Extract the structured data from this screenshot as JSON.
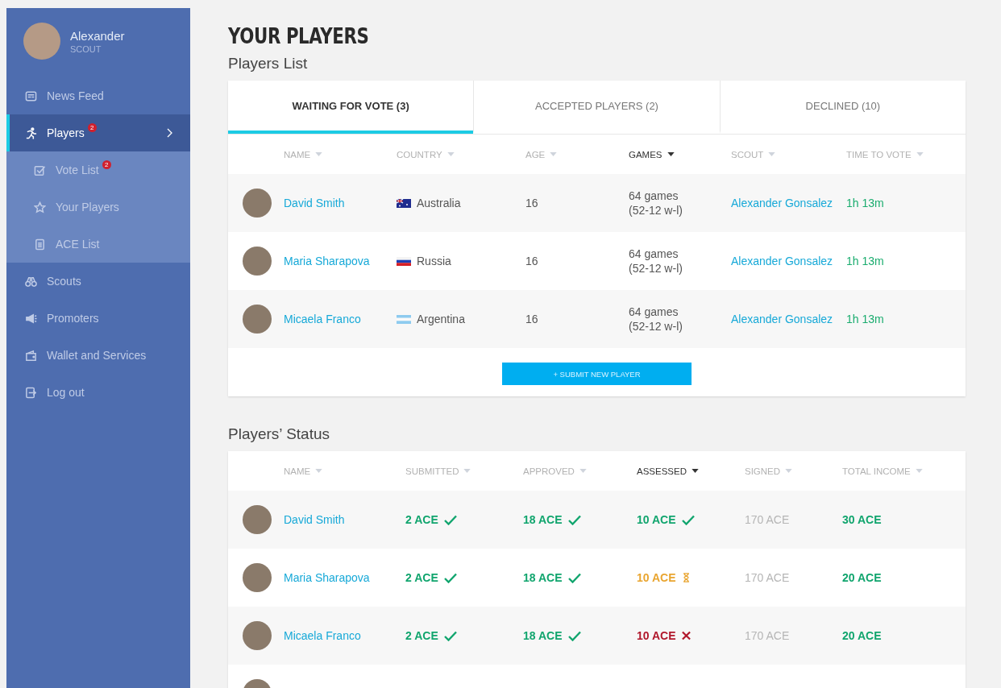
{
  "user": {
    "name": "Alexander",
    "role": "SCOUT"
  },
  "nav": [
    {
      "label": "News Feed",
      "selected": false
    },
    {
      "label": "Players",
      "selected": true,
      "badge": "2",
      "children": [
        {
          "label": "Vote List",
          "badge": "2",
          "selected": false
        },
        {
          "label": "Your Players",
          "selected": false
        },
        {
          "label": "ACE List",
          "selected": false
        }
      ]
    },
    {
      "label": "Scouts",
      "selected": false
    },
    {
      "label": "Promoters",
      "selected": false
    },
    {
      "label": "Wallet and Services",
      "selected": false
    },
    {
      "label": "Log out",
      "selected": false
    }
  ],
  "page_title": "YOUR PLAYERS",
  "list_title": "Players List",
  "tabs": [
    {
      "label": "WAITING FOR VOTE (3)",
      "selected": true
    },
    {
      "label": "ACCEPTED PLAYERS (2)",
      "selected": false
    },
    {
      "label": "DECLINED (10)",
      "selected": false
    }
  ],
  "list_columns": [
    {
      "label": "NAME",
      "sorted": false
    },
    {
      "label": "COUNTRY",
      "sorted": false
    },
    {
      "label": "AGE",
      "sorted": false
    },
    {
      "label": "GAMES",
      "sorted": true
    },
    {
      "label": "SCOUT",
      "sorted": false
    },
    {
      "label": "TIME TO VOTE",
      "sorted": false
    }
  ],
  "list_rows": [
    {
      "name": "David Smith",
      "country": "Australia",
      "age": "16",
      "games": "64 games",
      "record": "(52-12 w-l)",
      "scout": "Alexander Gonsalez",
      "time": "1h 13m"
    },
    {
      "name": "Maria Sharapova",
      "country": "Russia",
      "age": "16",
      "games": "64 games",
      "record": "(52-12 w-l)",
      "scout": "Alexander Gonsalez",
      "time": "1h 13m"
    },
    {
      "name": "Micaela Franco",
      "country": "Argentina",
      "age": "16",
      "games": "64 games",
      "record": "(52-12 w-l)",
      "scout": "Alexander Gonsalez",
      "time": "1h 13m"
    }
  ],
  "submit_button": "+ SUBMIT NEW PLAYER",
  "status_title": "Players’ Status",
  "status_columns": [
    {
      "label": "NAME",
      "sorted": false
    },
    {
      "label": "SUBMITTED",
      "sorted": false
    },
    {
      "label": "APPROVED",
      "sorted": false
    },
    {
      "label": "ASSESSED",
      "sorted": true
    },
    {
      "label": "SIGNED",
      "sorted": false
    },
    {
      "label": "TOTAL INCOME",
      "sorted": false
    }
  ],
  "status_rows": [
    {
      "name": "David Smith",
      "cells": [
        {
          "text": "2 ACE",
          "kind": "done"
        },
        {
          "text": "18 ACE",
          "kind": "done"
        },
        {
          "text": "10 ACE",
          "kind": "done"
        },
        {
          "text": "170 ACE",
          "kind": "muted"
        },
        {
          "text": "30 ACE",
          "kind": "income"
        }
      ]
    },
    {
      "name": "Maria Sharapova",
      "cells": [
        {
          "text": "2 ACE",
          "kind": "done"
        },
        {
          "text": "18 ACE",
          "kind": "done"
        },
        {
          "text": "10 ACE",
          "kind": "pending"
        },
        {
          "text": "170 ACE",
          "kind": "muted"
        },
        {
          "text": "20 ACE",
          "kind": "income"
        }
      ]
    },
    {
      "name": "Micaela Franco",
      "cells": [
        {
          "text": "2 ACE",
          "kind": "done"
        },
        {
          "text": "18 ACE",
          "kind": "done"
        },
        {
          "text": "10 ACE",
          "kind": "failed"
        },
        {
          "text": "170 ACE",
          "kind": "muted"
        },
        {
          "text": "20 ACE",
          "kind": "income"
        }
      ]
    },
    {
      "cells": []
    }
  ]
}
